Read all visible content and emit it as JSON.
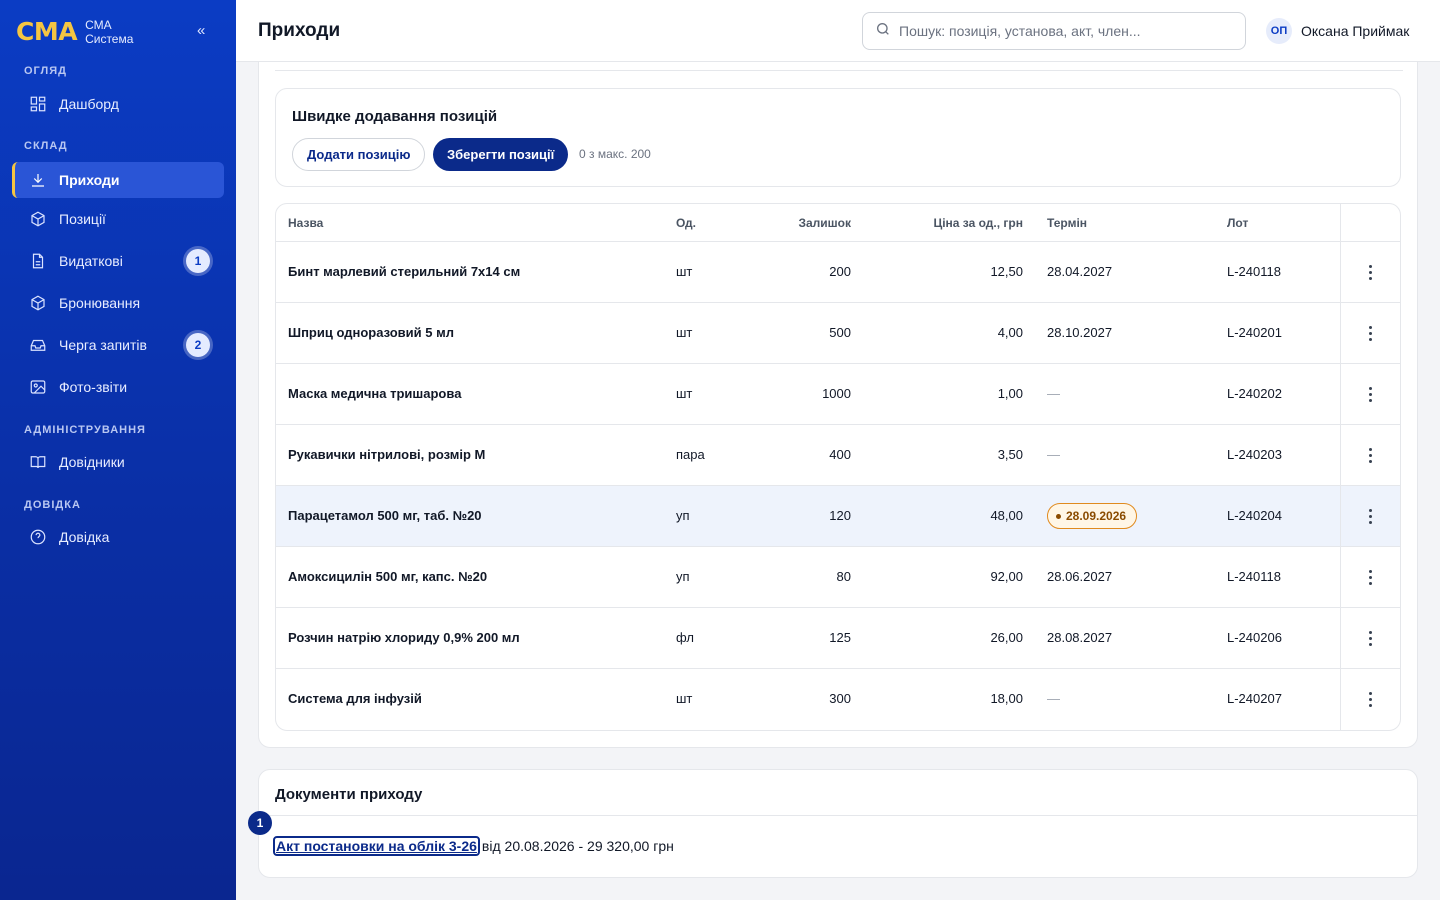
{
  "brand": {
    "logo": "СМА",
    "line1": "СМА",
    "line2": "Система",
    "collapse": "«"
  },
  "sidebar": {
    "sections": [
      {
        "title": "ОГЛЯД"
      },
      {
        "title": "СКЛАД"
      },
      {
        "title": "АДМІНІСТРУВАННЯ"
      },
      {
        "title": "ДОВІДКА"
      }
    ],
    "items": [
      {
        "label": "Дашборд",
        "icon": "grid-icon"
      },
      {
        "label": "Приходи",
        "icon": "download-icon",
        "active": true
      },
      {
        "label": "Позиції",
        "icon": "box-icon"
      },
      {
        "label": "Видаткові",
        "icon": "document-icon",
        "badge": "1"
      },
      {
        "label": "Бронювання",
        "icon": "box-icon"
      },
      {
        "label": "Черга запитів",
        "icon": "inbox-icon",
        "badge": "2"
      },
      {
        "label": "Фото-звіти",
        "icon": "image-icon"
      },
      {
        "label": "Довідники",
        "icon": "book-icon"
      },
      {
        "label": "Довідка",
        "icon": "help-circle-icon"
      }
    ]
  },
  "header": {
    "title": "Приходи",
    "search_placeholder": "Пошук: позиція, установа, акт, член...",
    "user": {
      "initials": "ОП",
      "name": "Оксана Приймак"
    }
  },
  "quick_add": {
    "title": "Швидке додавання позицій",
    "add_label": "Додати позицію",
    "save_label": "Зберегти позиції",
    "count": "0 з макс. 200"
  },
  "table": {
    "columns": {
      "name": "Назва",
      "unit": "Од.",
      "stock": "Залишок",
      "price": "Ціна за од., грн",
      "term": "Термін",
      "lot": "Лот"
    },
    "rows": [
      {
        "name": "Бинт марлевий стерильний 7х14 см",
        "unit": "шт",
        "stock": "200",
        "price": "12,50",
        "term": "28.04.2027",
        "lot": "L-240118"
      },
      {
        "name": "Шприц одноразовий 5 мл",
        "unit": "шт",
        "stock": "500",
        "price": "4,00",
        "term": "28.10.2027",
        "lot": "L-240201"
      },
      {
        "name": "Маска медична тришарова",
        "unit": "шт",
        "stock": "1000",
        "price": "1,00",
        "term": "—",
        "lot": "L-240202"
      },
      {
        "name": "Рукавички нітрилові, розмір M",
        "unit": "пара",
        "stock": "400",
        "price": "3,50",
        "term": "—",
        "lot": "L-240203"
      },
      {
        "name": "Парацетамол 500 мг, таб. №20",
        "unit": "уп",
        "stock": "120",
        "price": "48,00",
        "term": "28.09.2026",
        "lot": "L-240204",
        "term_warning": true
      },
      {
        "name": "Амоксицилін 500 мг, капс. №20",
        "unit": "уп",
        "stock": "80",
        "price": "92,00",
        "term": "28.06.2027",
        "lot": "L-240118"
      },
      {
        "name": "Розчин натрію хлориду 0,9% 200 мл",
        "unit": "фл",
        "stock": "125",
        "price": "26,00",
        "term": "28.08.2027",
        "lot": "L-240206"
      },
      {
        "name": "Система для інфузій",
        "unit": "шт",
        "stock": "300",
        "price": "18,00",
        "term": "—",
        "lot": "L-240207"
      }
    ]
  },
  "documents": {
    "title": "Документи приходу",
    "marker": "1",
    "link": "Акт постановки на облік 3-26",
    "rest": "від 20.08.2026 - 29 320,00 грн"
  },
  "colors": {
    "sidebar": "#0b3cc4",
    "brand_accent": "#f5c542",
    "primary": "#0b2a8a",
    "warning": "#e08a1e"
  }
}
